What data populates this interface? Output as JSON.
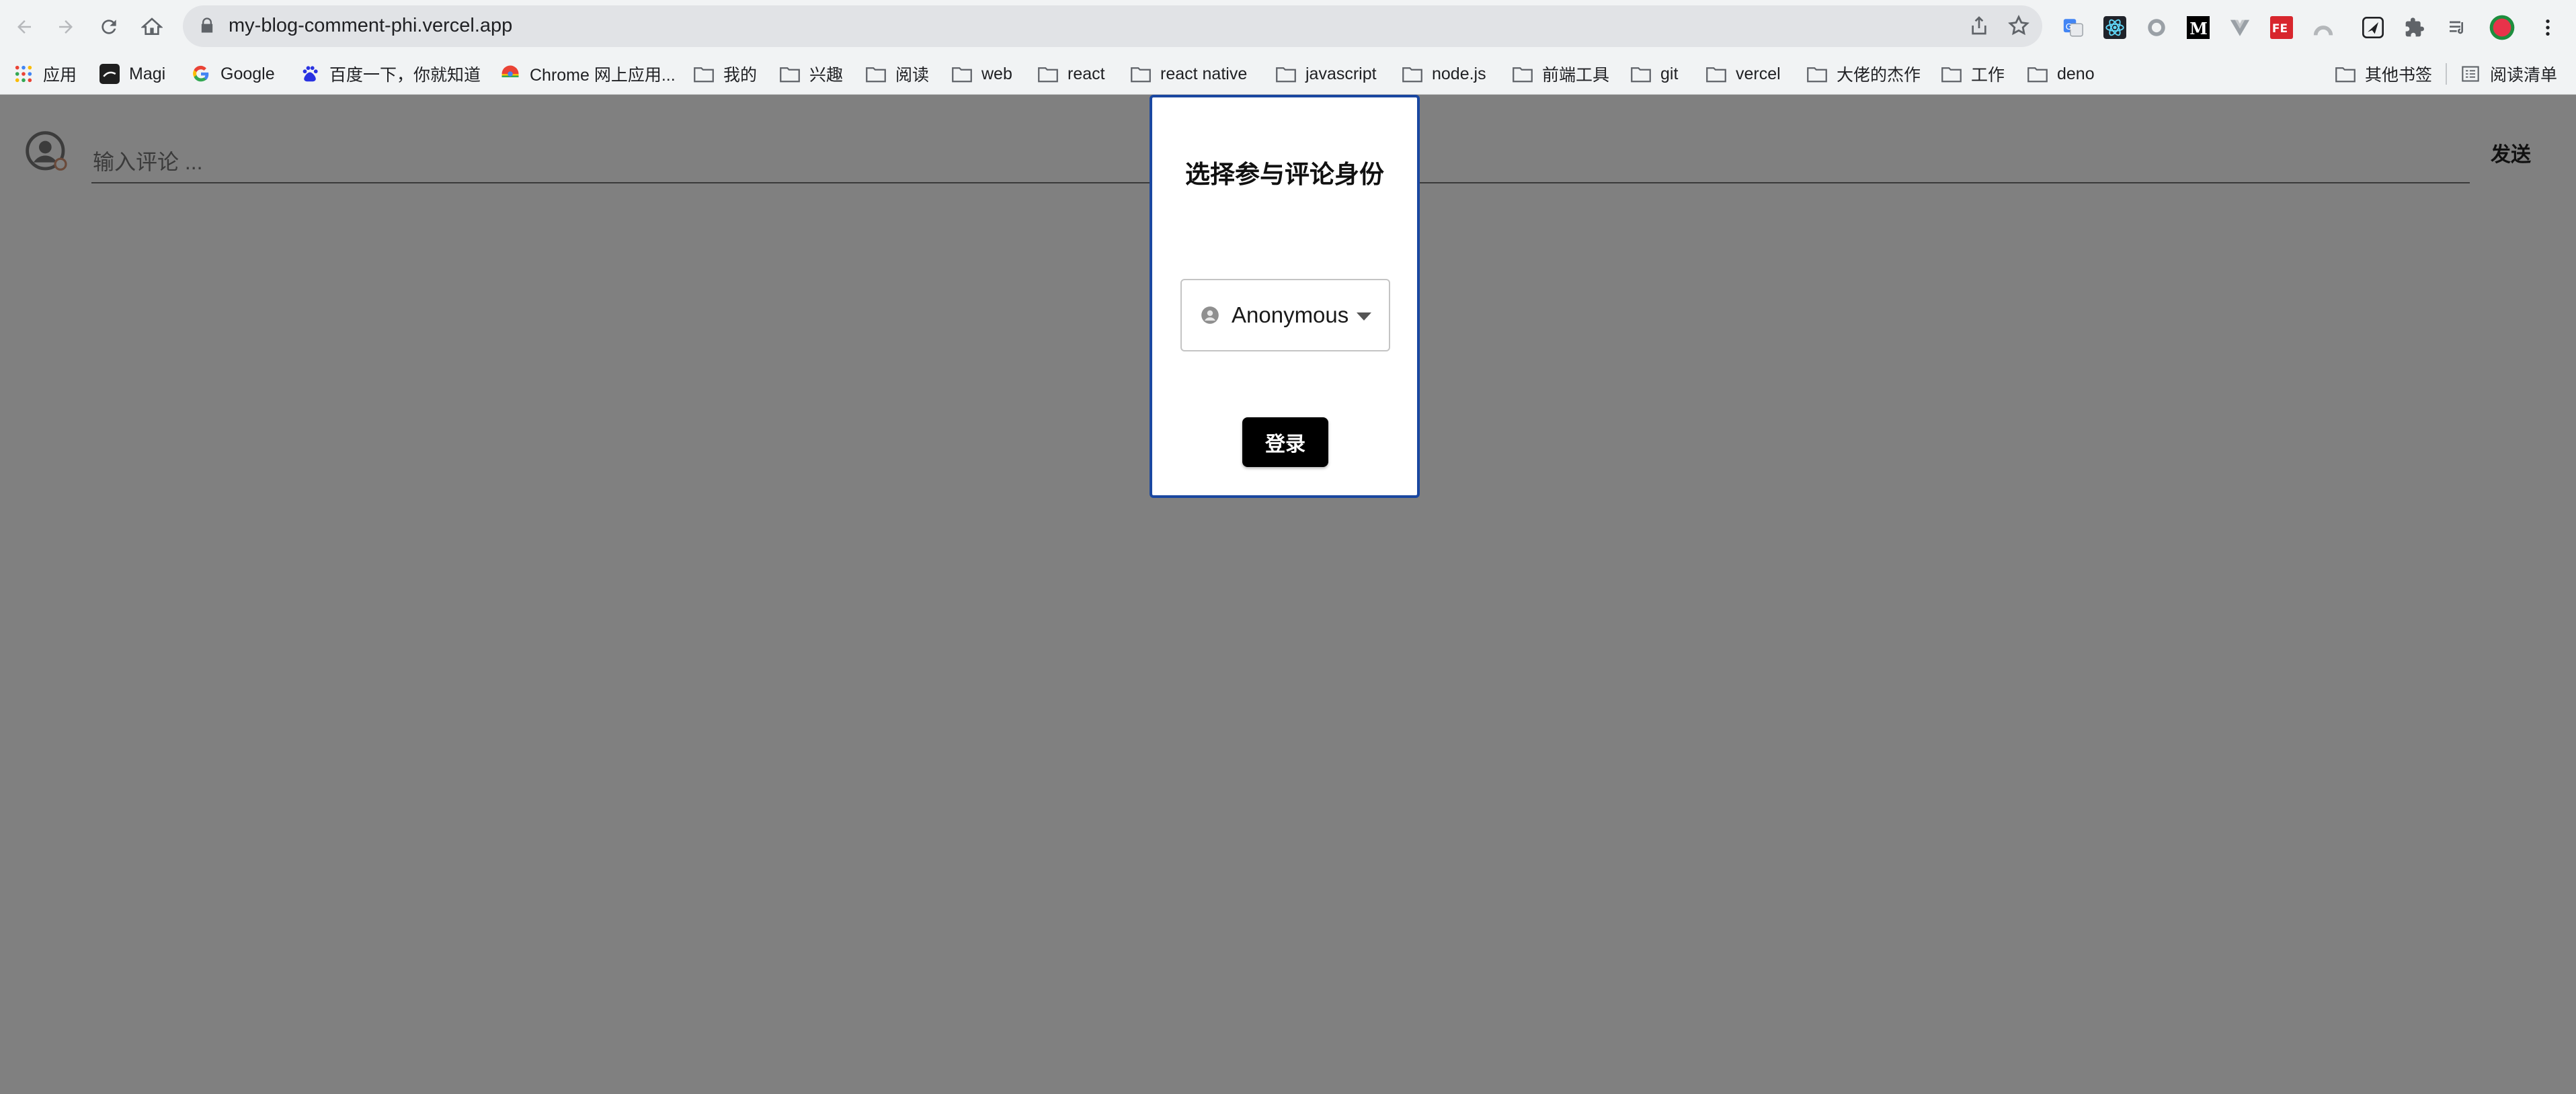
{
  "browser": {
    "url": "my-blog-comment-phi.vercel.app"
  },
  "bookmarks": {
    "left": [
      {
        "label": "应用",
        "icon": "apps-grid-icon"
      },
      {
        "label": "Magi",
        "icon": "magi-icon"
      },
      {
        "label": "Google",
        "icon": "google-icon"
      },
      {
        "label": "百度一下，你就知道",
        "icon": "baidu-icon"
      },
      {
        "label": "Chrome 网上应用...",
        "icon": "chrome-store-icon"
      },
      {
        "label": "我的",
        "icon": "folder-icon"
      },
      {
        "label": "兴趣",
        "icon": "folder-icon"
      },
      {
        "label": "阅读",
        "icon": "folder-icon"
      },
      {
        "label": "web",
        "icon": "folder-icon"
      },
      {
        "label": "react",
        "icon": "folder-icon"
      },
      {
        "label": "react native",
        "icon": "folder-icon"
      },
      {
        "label": "javascript",
        "icon": "folder-icon"
      },
      {
        "label": "node.js",
        "icon": "folder-icon"
      },
      {
        "label": "前端工具",
        "icon": "folder-icon"
      },
      {
        "label": "git",
        "icon": "folder-icon"
      },
      {
        "label": "vercel",
        "icon": "folder-icon"
      },
      {
        "label": "大佬的杰作",
        "icon": "folder-icon"
      },
      {
        "label": "工作",
        "icon": "folder-icon"
      },
      {
        "label": "deno",
        "icon": "folder-icon"
      }
    ],
    "other": "其他书签",
    "reading_list": "阅读清单"
  },
  "comment": {
    "placeholder": "输入评论 ...",
    "send_label": "发送"
  },
  "modal": {
    "title": "选择参与评论身份",
    "identity_selected": "Anonymous",
    "login_label": "登录"
  },
  "colors": {
    "overlay": "#808080",
    "modal_border": "#1a47a0",
    "login_button": "#000000"
  }
}
